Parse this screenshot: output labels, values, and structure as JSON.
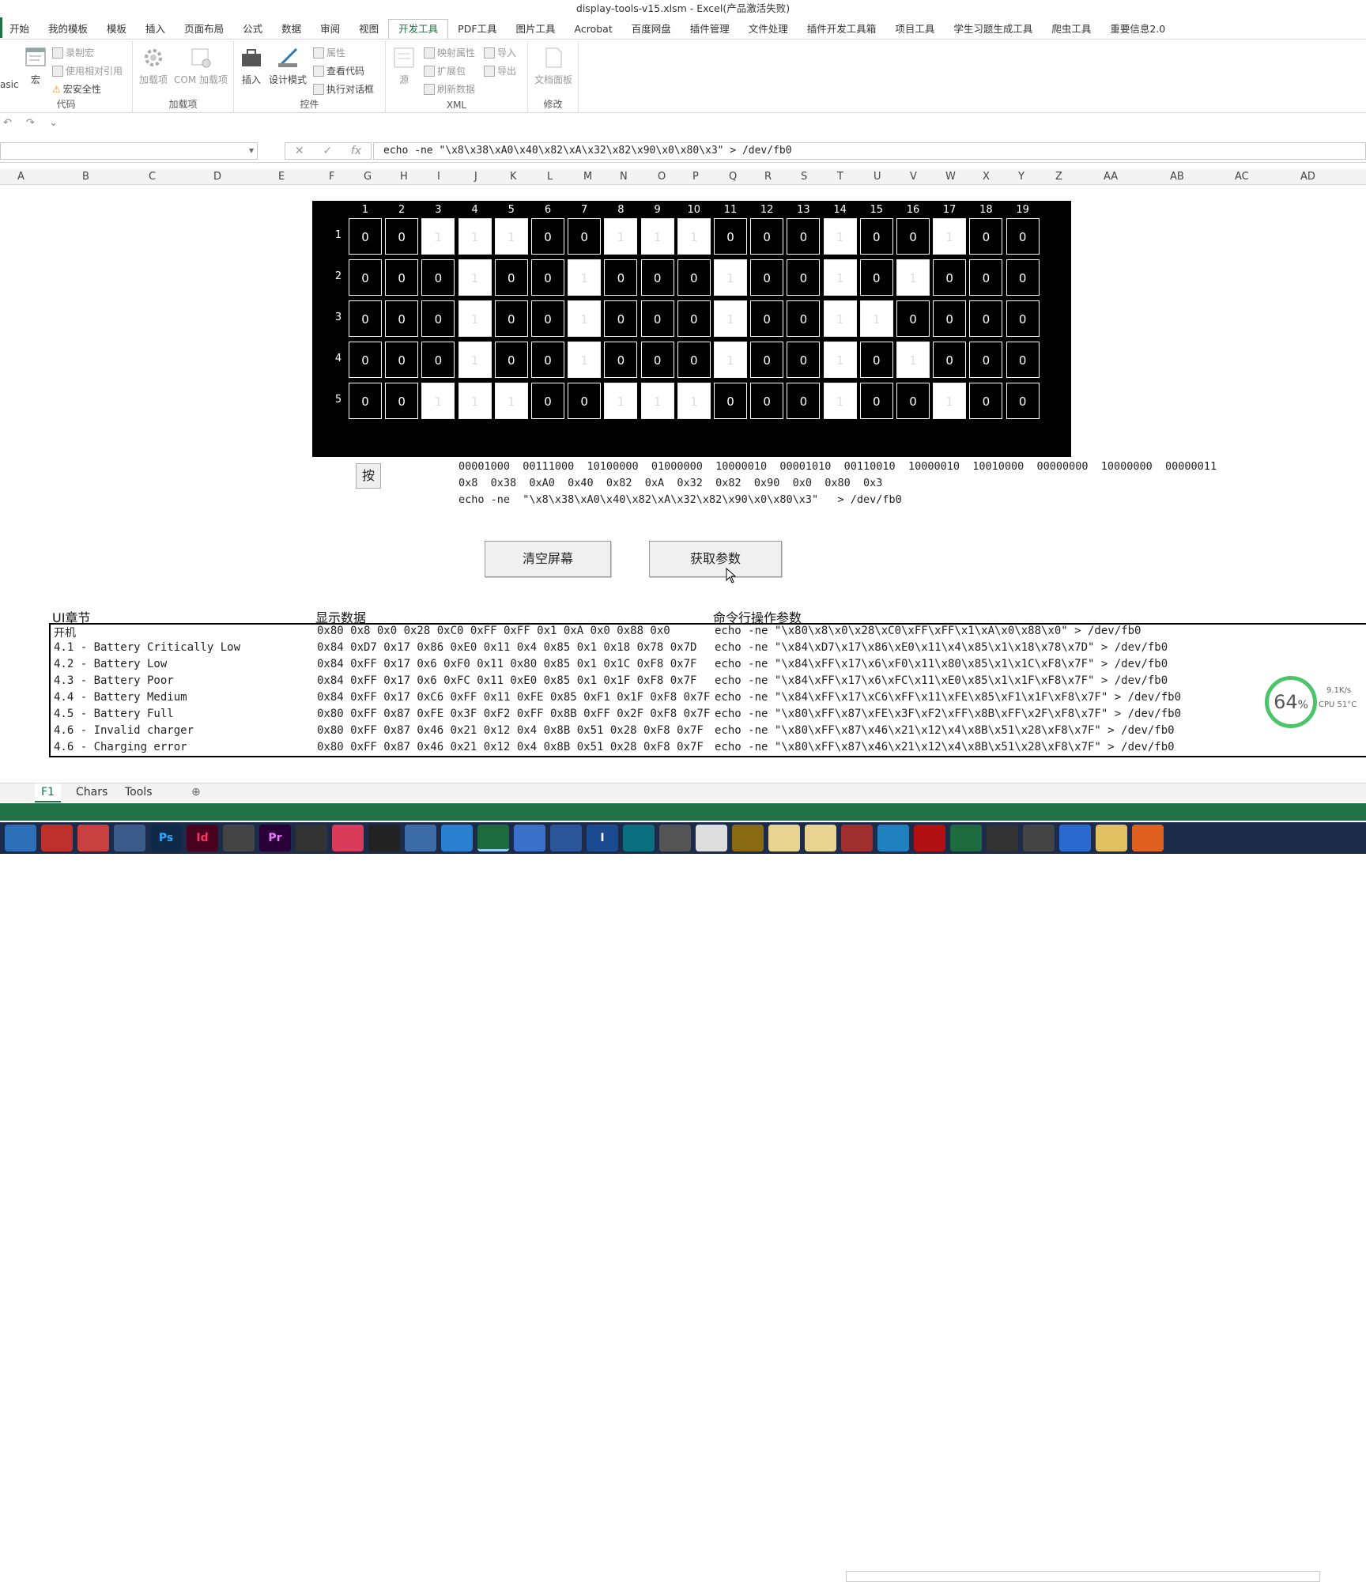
{
  "window": {
    "title": "display-tools-v15.xlsm - Excel(产品激活失败)"
  },
  "ribbon_tabs": [
    "开始",
    "我的模板",
    "模板",
    "插入",
    "页面布局",
    "公式",
    "数据",
    "审阅",
    "视图",
    "开发工具",
    "PDF工具",
    "图片工具",
    "Acrobat",
    "百度网盘",
    "插件管理",
    "文件处理",
    "插件开发工具箱",
    "项目工具",
    "学生习题生成工具",
    "爬虫工具",
    "重要信息2.0"
  ],
  "ribbon": {
    "code": {
      "label": "代码",
      "basic": "asic",
      "macro": "宏",
      "record": "录制宏",
      "relative": "使用相对引用",
      "security": "宏安全性"
    },
    "addins": {
      "label": "加载项",
      "addin": "加载项",
      "com": "COM 加载项"
    },
    "controls": {
      "label": "控件",
      "insert": "插入",
      "design": "设计模式",
      "props": "属性",
      "viewcode": "查看代码",
      "dialog": "执行对话框"
    },
    "xml": {
      "label": "XML",
      "source": "源",
      "map": "映射属性",
      "ext": "扩展包",
      "refresh": "刷新数据",
      "import": "导入",
      "export": "导出"
    },
    "modify": {
      "label": "修改",
      "docpanel": "文档面板"
    }
  },
  "formula": {
    "cancel": "✕",
    "enter": "✓",
    "fx": "fx",
    "value": "echo -ne  \"\\x8\\x38\\xA0\\x40\\x82\\xA\\x32\\x82\\x90\\x0\\x80\\x3\"  > /dev/fb0"
  },
  "columns": [
    "A",
    "B",
    "C",
    "D",
    "E",
    "F",
    "G",
    "H",
    "I",
    "J",
    "K",
    "L",
    "M",
    "N",
    "O",
    "P",
    "Q",
    "R",
    "S",
    "T",
    "U",
    "V",
    "W",
    "X",
    "Y",
    "Z",
    "AA",
    "AB",
    "AC",
    "AD"
  ],
  "matrix": {
    "col_numbers": [
      "1",
      "2",
      "3",
      "4",
      "5",
      "6",
      "7",
      "8",
      "9",
      "10",
      "11",
      "12",
      "13",
      "14",
      "15",
      "16",
      "17",
      "18",
      "19"
    ],
    "row_numbers": [
      "1",
      "2",
      "3",
      "4",
      "5"
    ],
    "rows": [
      [
        "0",
        "0",
        "1",
        "1",
        "1",
        "0",
        "0",
        "1",
        "1",
        "1",
        "0",
        "0",
        "0",
        "1",
        "0",
        "0",
        "1",
        "0",
        "0"
      ],
      [
        "0",
        "0",
        "0",
        "1",
        "0",
        "0",
        "1",
        "0",
        "0",
        "0",
        "1",
        "0",
        "0",
        "1",
        "0",
        "1",
        "0",
        "0",
        "0"
      ],
      [
        "0",
        "0",
        "0",
        "1",
        "0",
        "0",
        "1",
        "0",
        "0",
        "0",
        "1",
        "0",
        "0",
        "1",
        "1",
        "0",
        "0",
        "0",
        "0"
      ],
      [
        "0",
        "0",
        "0",
        "1",
        "0",
        "0",
        "1",
        "0",
        "0",
        "0",
        "1",
        "0",
        "0",
        "1",
        "0",
        "1",
        "0",
        "0",
        "0"
      ],
      [
        "0",
        "0",
        "1",
        "1",
        "1",
        "0",
        "0",
        "1",
        "1",
        "1",
        "0",
        "0",
        "0",
        "1",
        "0",
        "0",
        "1",
        "0",
        "0"
      ]
    ]
  },
  "press_button": "按",
  "output": {
    "binary": "00001000  00111000  10100000  01000000  10000010  00001010  00110010  10000010  10010000  00000000  10000000  00000011",
    "hex": "0x8  0x38  0xA0  0x40  0x82  0xA  0x32  0x82  0x90  0x0  0x80  0x3",
    "command": "echo -ne  \"\\x8\\x38\\xA0\\x40\\x82\\xA\\x32\\x82\\x90\\x0\\x80\\x3\"   > /dev/fb0"
  },
  "buttons": {
    "clear": "清空屏幕",
    "get": "获取参数"
  },
  "table": {
    "headers": {
      "ui": "UI章节",
      "display": "显示数据",
      "cmd": "命令行操作参数"
    },
    "rows": [
      {
        "ui": "开机",
        "display": "0x80  0x8  0x0  0x28  0xC0  0xFF  0xFF  0x1  0xA  0x0  0x88  0x0",
        "cmd": "echo -ne  \"\\x80\\x8\\x0\\x28\\xC0\\xFF\\xFF\\x1\\xA\\x0\\x88\\x0\"   > /dev/fb0"
      },
      {
        "ui": "4.1 - Battery Critically Low",
        "display": "0x84  0xD7  0x17  0x86  0xE0  0x11  0x4  0x85  0x1  0x18  0x78  0x7D",
        "cmd": "echo -ne  \"\\x84\\xD7\\x17\\x86\\xE0\\x11\\x4\\x85\\x1\\x18\\x78\\x7D\"   > /dev/fb0"
      },
      {
        "ui": "4.2 - Battery Low",
        "display": "0x84  0xFF  0x17  0x6  0xF0  0x11  0x80  0x85  0x1  0x1C  0xF8  0x7F",
        "cmd": "echo -ne  \"\\x84\\xFF\\x17\\x6\\xF0\\x11\\x80\\x85\\x1\\x1C\\xF8\\x7F\"   > /dev/fb0"
      },
      {
        "ui": "4.3 - Battery Poor",
        "display": "0x84  0xFF  0x17  0x6  0xFC  0x11  0xE0  0x85  0x1  0x1F  0xF8  0x7F",
        "cmd": "echo -ne  \"\\x84\\xFF\\x17\\x6\\xFC\\x11\\xE0\\x85\\x1\\x1F\\xF8\\x7F\"   > /dev/fb0"
      },
      {
        "ui": "4.4 - Battery Medium",
        "display": "0x84  0xFF  0x17  0xC6  0xFF  0x11  0xFE  0x85  0xF1  0x1F  0xF8  0x7F",
        "cmd": "echo -ne  \"\\x84\\xFF\\x17\\xC6\\xFF\\x11\\xFE\\x85\\xF1\\x1F\\xF8\\x7F\"   > /dev/fb0"
      },
      {
        "ui": "4.5 - Battery Full",
        "display": "0x80  0xFF  0x87  0xFE  0x3F  0xF2  0xFF  0x8B  0xFF  0x2F  0xF8  0x7F",
        "cmd": "echo -ne  \"\\x80\\xFF\\x87\\xFE\\x3F\\xF2\\xFF\\x8B\\xFF\\x2F\\xF8\\x7F\"   > /dev/fb0"
      },
      {
        "ui": "4.6 - Invalid charger",
        "display": "0x80  0xFF  0x87  0x46  0x21  0x12  0x4  0x8B  0x51  0x28  0xF8  0x7F",
        "cmd": "echo -ne  \"\\x80\\xFF\\x87\\x46\\x21\\x12\\x4\\x8B\\x51\\x28\\xF8\\x7F\"   > /dev/fb0"
      },
      {
        "ui": "4.6 - Charging error",
        "display": "0x80  0xFF  0x87  0x46  0x21  0x12  0x4  0x8B  0x51  0x28  0xF8  0x7F",
        "cmd": "echo -ne  \"\\x80\\xFF\\x87\\x46\\x21\\x12\\x4\\x8B\\x51\\x28\\xF8\\x7F\"   > /dev/fb0"
      }
    ]
  },
  "sheet_tabs": [
    "F1",
    "Chars",
    "Tools"
  ],
  "perf": {
    "value": "64",
    "unit": "%",
    "net": "9.1K/s",
    "cpu": "CPU 51°C"
  },
  "taskbar_icons": [
    "Ps",
    "Id",
    "Pr",
    "I"
  ],
  "colors": {
    "excel_green": "#217346",
    "taskbar": "#1c2b4a"
  }
}
